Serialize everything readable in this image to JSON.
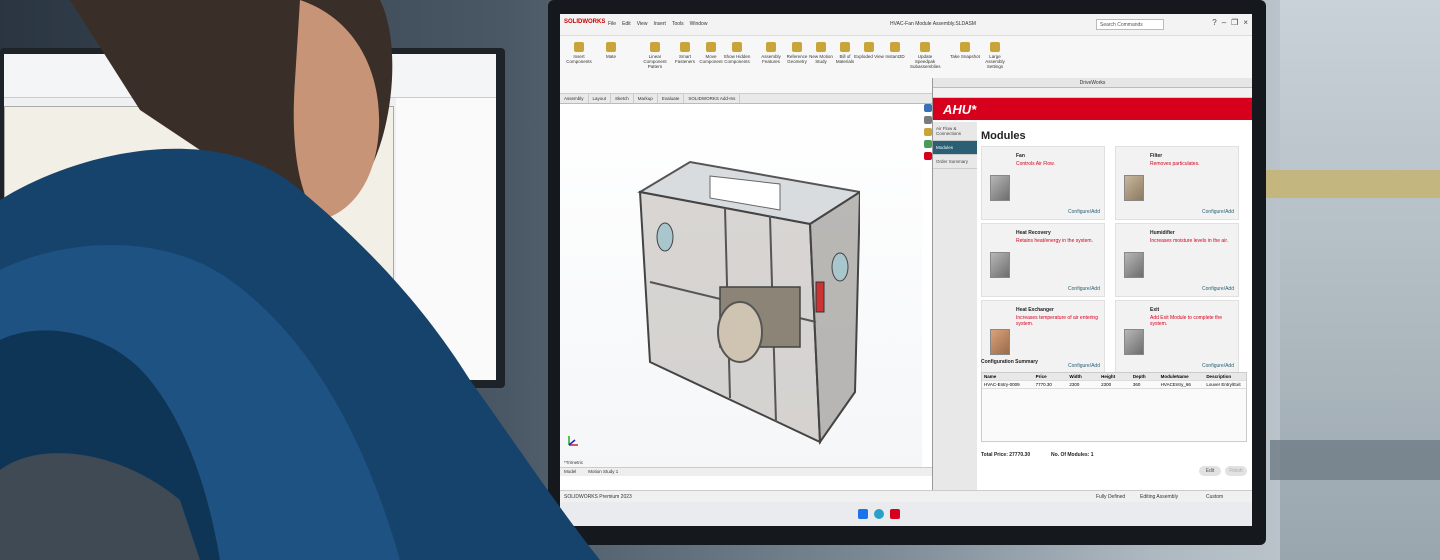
{
  "window": {
    "title": "HVAC-Fan Module Assembly.SLDASM",
    "search_placeholder": "Search Commands",
    "app_name": "SOLIDWORKS"
  },
  "menu": [
    "File",
    "Edit",
    "View",
    "Insert",
    "Tools",
    "Window"
  ],
  "ribbon": [
    "Insert Components",
    "Mate",
    "Linear Component Pattern",
    "Smart Fasteners",
    "Move Component",
    "Show Hidden Components",
    "Assembly Features",
    "Reference Geometry",
    "New Motion Study",
    "Bill of Materials",
    "Exploded View",
    "Instant3D",
    "Update Speedpak Subassemblies",
    "Take Snapshot",
    "Large Assembly Settings"
  ],
  "command_tabs": [
    "Assembly",
    "Layout",
    "Sketch",
    "Markup",
    "Evaluate",
    "SOLIDWORKS Add-Ins"
  ],
  "bottom_tabs": [
    "Model",
    "Motion Study 1"
  ],
  "view_label": "*Trimetric",
  "driveworks": {
    "header": "DriveWorks",
    "logo": "AHU*",
    "nav": [
      "Air Flow & Connections",
      "Modules",
      "Order Summary"
    ],
    "page_title": "Modules",
    "configure_label": "Configure/Add",
    "cards": [
      {
        "title": "Fan",
        "desc": "Controls Air Flow."
      },
      {
        "title": "Filter",
        "desc": "Removes particulates."
      },
      {
        "title": "Heat Recovery",
        "desc": "Retains heat/energy in the system."
      },
      {
        "title": "Humidifier",
        "desc": "Increases moisture levels in the air."
      },
      {
        "title": "Heat Exchanger",
        "desc": "Increases temperature of air entering system."
      },
      {
        "title": "Exit",
        "desc": "Add Exit Module to complete the system."
      }
    ],
    "summary_title": "Configuration Summary",
    "summary_headers": [
      "Name",
      "Price",
      "Width",
      "Height",
      "Depth",
      "ModuleName",
      "Description"
    ],
    "summary_rows": [
      [
        "HVAC-Entry-0009",
        "7770.30",
        "2300",
        "2300",
        "360",
        "HVACEntry_66",
        "Louver Entry/Exit"
      ]
    ],
    "total_price": "Total Price: 27770.30",
    "num_modules": "No. Of Modules: 1",
    "edit_button": "Edit",
    "finish_button": "Finish"
  },
  "status": {
    "version": "SOLIDWORKS Premium 2023",
    "state": "Fully Defined",
    "mode": "Editing Assembly",
    "units": "Custom"
  }
}
